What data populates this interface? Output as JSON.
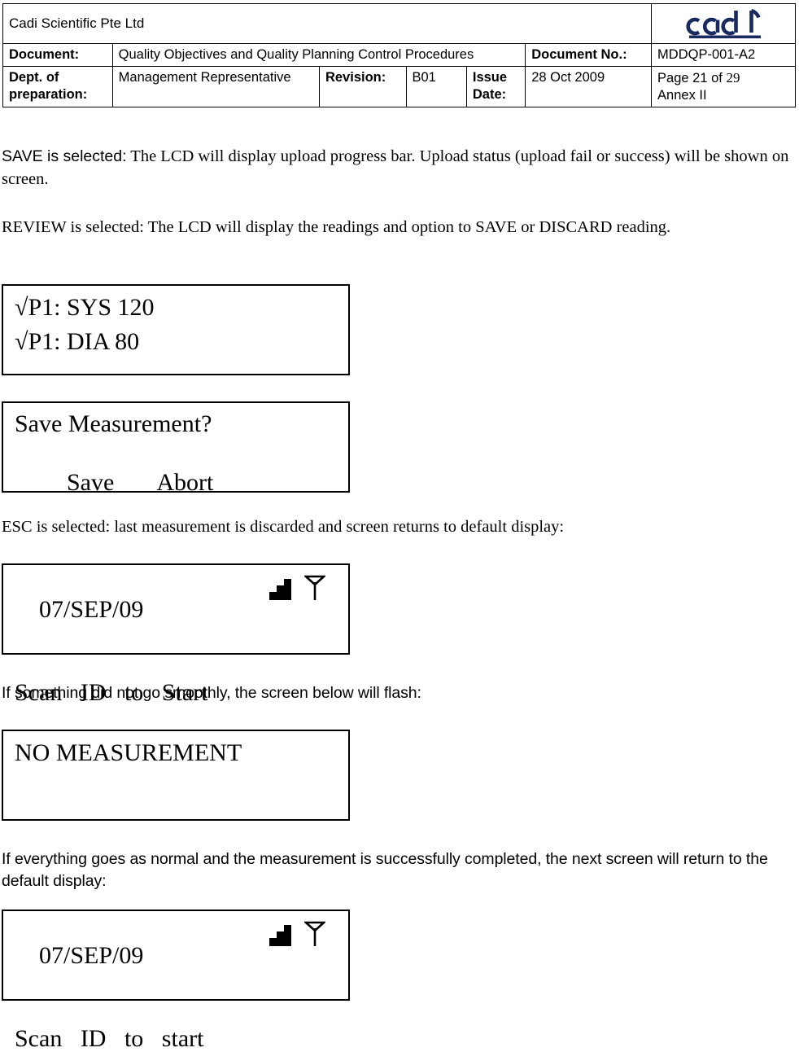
{
  "header": {
    "company": "Cadi Scientific Pte Ltd",
    "logo_text": "cadi",
    "logo_icon": "cadi-logo",
    "row_document_label": "Document:",
    "row_document_value": "Quality Objectives and Quality Planning Control Procedures",
    "doc_no_label": "Document No.:",
    "doc_no_value": "MDDQP-001-A2",
    "dept_label": "Dept. of preparation:",
    "dept_value": "Management Representative",
    "revision_label": "Revision:",
    "revision_value": "B01",
    "issue_date_label": "Issue Date:",
    "issue_date_value": "28 Oct 2009",
    "page_prefix": "Page 21 of ",
    "page_total": "29",
    "annex": "Annex II"
  },
  "body": {
    "p1_lead": "SAVE is selected:",
    "p1_rest": " The LCD will display upload progress bar. Upload status (upload fail or success) will be shown on screen.",
    "p2": "REVIEW is selected: The LCD will display the readings and option to SAVE or DISCARD reading.",
    "p3": "ESC is selected: last measurement is discarded and screen returns to default display:",
    "p4": "If something did not go smoothly, the screen below will flash:",
    "p5": "If everything goes as normal and the measurement is successfully completed, the next screen will return to the default display:"
  },
  "lcd_screens": {
    "readings": {
      "line1": "√P1: SYS 120",
      "line2": "√P1: DIA 80"
    },
    "save_prompt": {
      "line1": "Save Measurement?",
      "option_save": "Save",
      "option_abort": "Abort"
    },
    "default_display_1": {
      "date": "07/SEP/09",
      "line2": "Scan   ID   to   Start",
      "signal_icon": "signal-bars-icon",
      "antenna_icon": "antenna-icon"
    },
    "no_measurement": {
      "line1": "NO MEASUREMENT"
    },
    "default_display_2": {
      "date": "07/SEP/09",
      "line2": "Scan   ID   to   start",
      "signal_icon": "signal-bars-icon",
      "antenna_icon": "antenna-icon"
    }
  },
  "colors": {
    "logo_navy": "#1b2a5e",
    "border": "#000000",
    "text": "#000000"
  }
}
